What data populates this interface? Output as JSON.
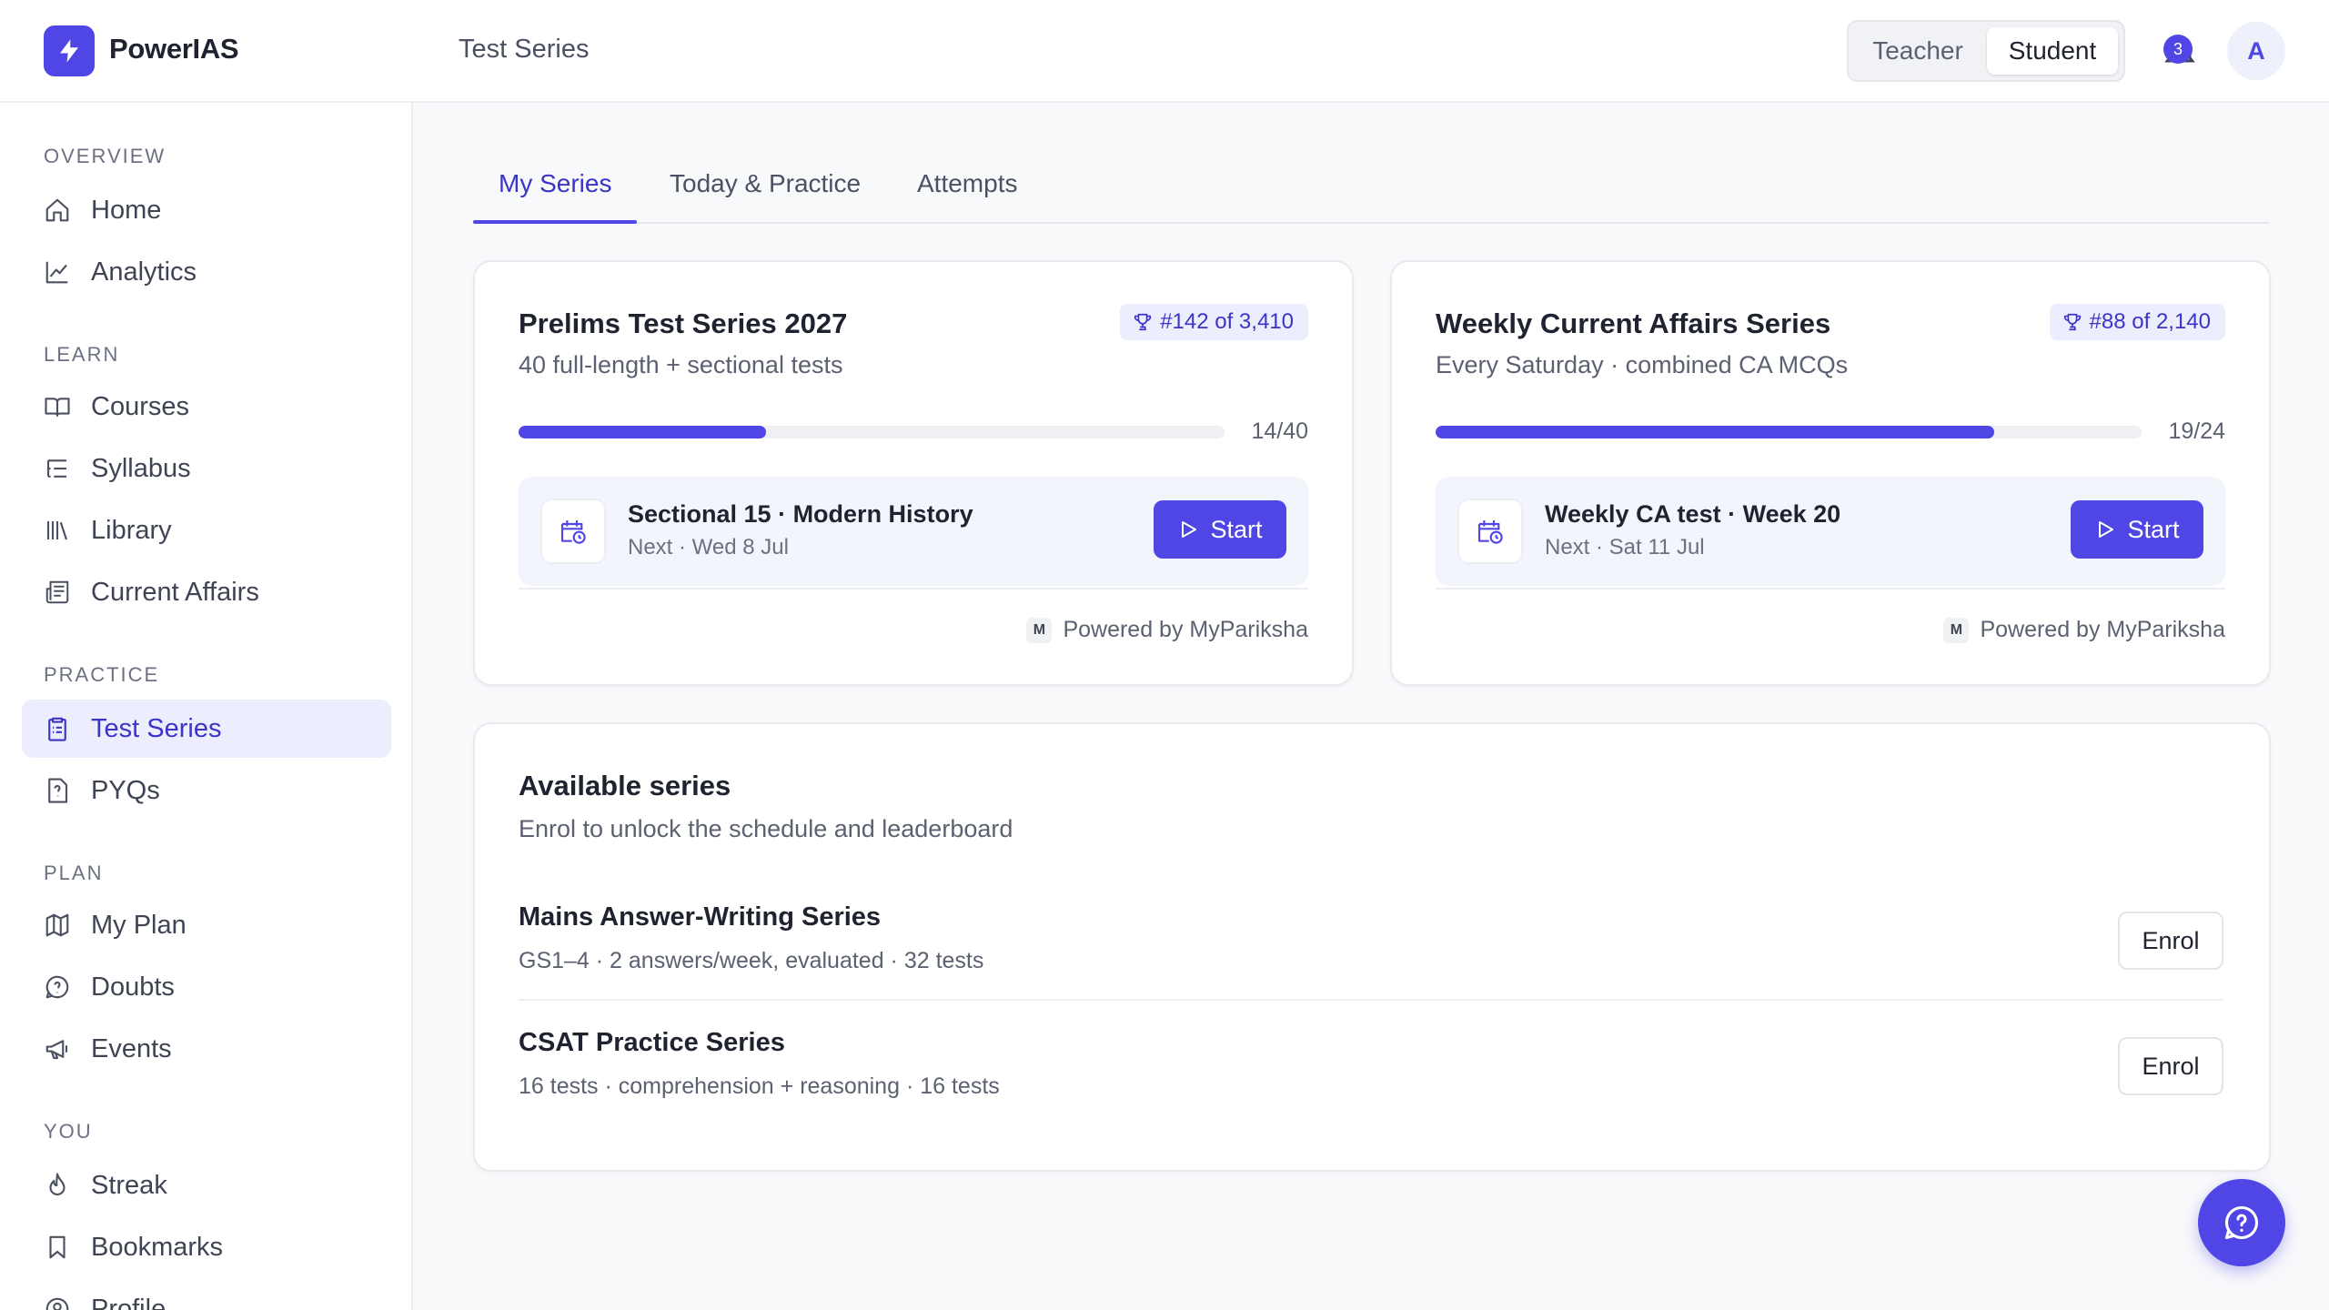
{
  "app": {
    "brand": "PowerIAS",
    "page_title": "Test Series"
  },
  "header": {
    "roles": [
      "Teacher",
      "Student"
    ],
    "active_role": "Student",
    "notification_count": "3",
    "avatar_initial": "A"
  },
  "sidebar": {
    "sections": [
      {
        "label": "OVERVIEW",
        "items": [
          {
            "label": "Home",
            "icon": "home-icon"
          },
          {
            "label": "Analytics",
            "icon": "chart-line-icon"
          }
        ]
      },
      {
        "label": "LEARN",
        "items": [
          {
            "label": "Courses",
            "icon": "book-open-icon"
          },
          {
            "label": "Syllabus",
            "icon": "list-tree-icon"
          },
          {
            "label": "Library",
            "icon": "library-icon"
          },
          {
            "label": "Current Affairs",
            "icon": "newspaper-icon"
          }
        ]
      },
      {
        "label": "PRACTICE",
        "items": [
          {
            "label": "Test Series",
            "icon": "clipboard-list-icon",
            "active": true
          },
          {
            "label": "PYQs",
            "icon": "file-question-icon"
          }
        ]
      },
      {
        "label": "PLAN",
        "items": [
          {
            "label": "My Plan",
            "icon": "map-icon"
          },
          {
            "label": "Doubts",
            "icon": "message-question-icon"
          },
          {
            "label": "Events",
            "icon": "megaphone-icon"
          }
        ]
      },
      {
        "label": "YOU",
        "items": [
          {
            "label": "Streak",
            "icon": "flame-icon"
          },
          {
            "label": "Bookmarks",
            "icon": "bookmark-icon"
          },
          {
            "label": "Profile",
            "icon": "user-circle-icon"
          }
        ]
      }
    ]
  },
  "tabs": [
    {
      "label": "My Series",
      "active": true
    },
    {
      "label": "Today & Practice"
    },
    {
      "label": "Attempts"
    }
  ],
  "my_series": [
    {
      "title": "Prelims Test Series 2027",
      "subtitle": "40 full-length + sectional tests",
      "rank": "#142 of 3,410",
      "progress_done": 14,
      "progress_total": 40,
      "progress_label": "14/40",
      "next_title": "Sectional 15 · Modern History",
      "next_date": "Next · Wed 8 Jul",
      "start_label": "Start",
      "powered_mark": "M",
      "powered_by": "Powered by MyPariksha"
    },
    {
      "title": "Weekly Current Affairs Series",
      "subtitle": "Every Saturday · combined CA MCQs",
      "rank": "#88 of 2,140",
      "progress_done": 19,
      "progress_total": 24,
      "progress_label": "19/24",
      "next_title": "Weekly CA test · Week 20",
      "next_date": "Next · Sat 11 Jul",
      "start_label": "Start",
      "powered_mark": "M",
      "powered_by": "Powered by MyPariksha"
    }
  ],
  "available": {
    "title": "Available series",
    "subtitle": "Enrol to unlock the schedule and leaderboard",
    "items": [
      {
        "title": "Mains Answer-Writing Series",
        "meta": "GS1–4 · 2 answers/week, evaluated · 32 tests",
        "action": "Enrol"
      },
      {
        "title": "CSAT Practice Series",
        "meta": "16 tests · comprehension + reasoning · 16 tests",
        "action": "Enrol"
      }
    ]
  },
  "colors": {
    "accent": "#4f46e5",
    "accent_soft": "#eceefd",
    "text": "#1f2330",
    "muted": "#5b6170"
  }
}
